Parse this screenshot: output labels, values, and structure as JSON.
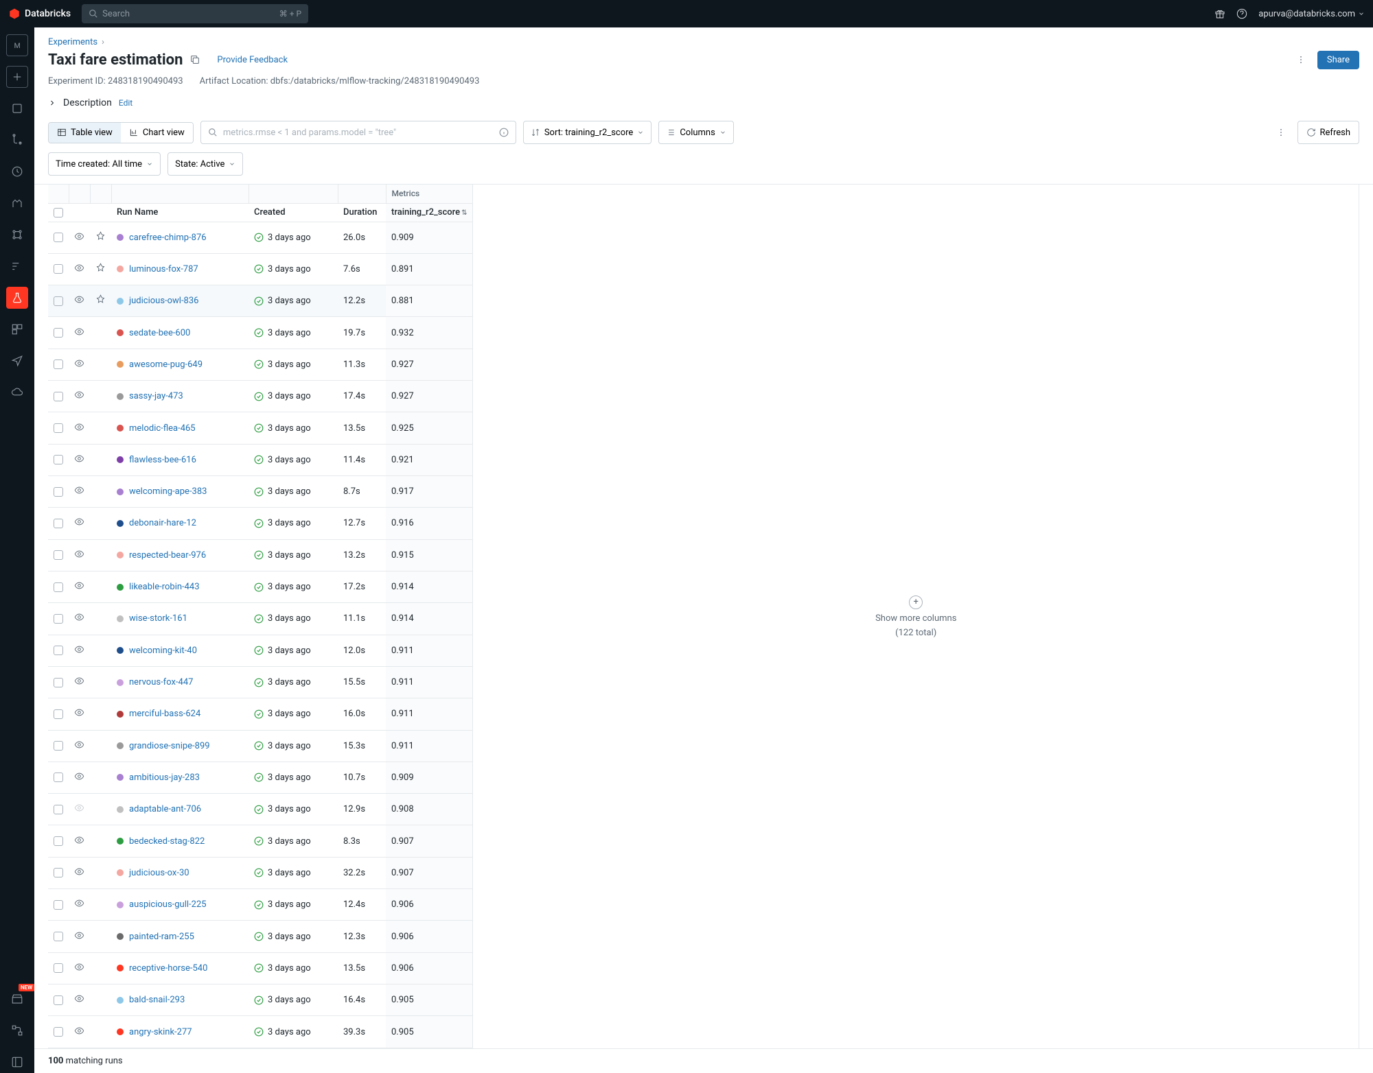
{
  "brand": "Databricks",
  "search": {
    "placeholder": "Search",
    "shortcut": "⌘ + P"
  },
  "user_email": "apurva@databricks.com",
  "breadcrumb": {
    "parent": "Experiments"
  },
  "page": {
    "title": "Taxi fare estimation",
    "feedback": "Provide Feedback",
    "share": "Share",
    "experiment_id_label": "Experiment ID:",
    "experiment_id": "248318190490493",
    "artifact_label": "Artifact Location:",
    "artifact_location": "dbfs:/databricks/mlflow-tracking/248318190490493",
    "description_label": "Description",
    "edit": "Edit"
  },
  "toolbar": {
    "table_view": "Table view",
    "chart_view": "Chart view",
    "filter_placeholder": "metrics.rmse < 1 and params.model = \"tree\"",
    "sort_label": "Sort: training_r2_score",
    "columns_label": "Columns",
    "refresh": "Refresh"
  },
  "filters": {
    "time": "Time created: All time",
    "state": "State: Active"
  },
  "table": {
    "group_metrics": "Metrics",
    "cols": {
      "run_name": "Run Name",
      "created": "Created",
      "duration": "Duration",
      "metric": "training_r2_score"
    },
    "created_text": "3 days ago",
    "more_cols_line1": "Show more columns",
    "more_cols_line2": "(122 total)"
  },
  "footer": {
    "count": "100",
    "label": "matching runs"
  },
  "new_badge": "NEW",
  "runs": [
    {
      "name": "carefree-chimp-876",
      "color": "#a87fd1",
      "duration": "26.0s",
      "metric": "0.909",
      "pinned": true
    },
    {
      "name": "luminous-fox-787",
      "color": "#f4a7a0",
      "duration": "7.6s",
      "metric": "0.891",
      "pinned": true
    },
    {
      "name": "judicious-owl-836",
      "color": "#8ec8e8",
      "duration": "12.2s",
      "metric": "0.881",
      "pinned": true,
      "hover": true
    },
    {
      "name": "sedate-bee-600",
      "color": "#d9534f",
      "duration": "19.7s",
      "metric": "0.932"
    },
    {
      "name": "awesome-pug-649",
      "color": "#e89c5e",
      "duration": "11.3s",
      "metric": "0.927"
    },
    {
      "name": "sassy-jay-473",
      "color": "#9a9a9a",
      "duration": "17.4s",
      "metric": "0.927"
    },
    {
      "name": "melodic-flea-465",
      "color": "#d9534f",
      "duration": "13.5s",
      "metric": "0.925"
    },
    {
      "name": "flawless-bee-616",
      "color": "#7e3fa8",
      "duration": "11.4s",
      "metric": "0.921"
    },
    {
      "name": "welcoming-ape-383",
      "color": "#a87fd1",
      "duration": "8.7s",
      "metric": "0.917"
    },
    {
      "name": "debonair-hare-12",
      "color": "#1f4e8c",
      "duration": "12.7s",
      "metric": "0.916"
    },
    {
      "name": "respected-bear-976",
      "color": "#f4a7a0",
      "duration": "13.2s",
      "metric": "0.915"
    },
    {
      "name": "likeable-robin-443",
      "color": "#2d9d41",
      "duration": "17.2s",
      "metric": "0.914"
    },
    {
      "name": "wise-stork-161",
      "color": "#c0c0c0",
      "duration": "11.1s",
      "metric": "0.914"
    },
    {
      "name": "welcoming-kit-40",
      "color": "#1f4e8c",
      "duration": "12.0s",
      "metric": "0.911"
    },
    {
      "name": "nervous-fox-447",
      "color": "#c9a0dc",
      "duration": "15.5s",
      "metric": "0.911"
    },
    {
      "name": "merciful-bass-624",
      "color": "#b03a3a",
      "duration": "16.0s",
      "metric": "0.911"
    },
    {
      "name": "grandiose-snipe-899",
      "color": "#9a9a9a",
      "duration": "15.3s",
      "metric": "0.911"
    },
    {
      "name": "ambitious-jay-283",
      "color": "#a87fd1",
      "duration": "10.7s",
      "metric": "0.909"
    },
    {
      "name": "adaptable-ant-706",
      "color": "#c0c0c0",
      "duration": "12.9s",
      "metric": "0.908",
      "hidden": true
    },
    {
      "name": "bedecked-stag-822",
      "color": "#2d9d41",
      "duration": "8.3s",
      "metric": "0.907"
    },
    {
      "name": "judicious-ox-30",
      "color": "#f4a7a0",
      "duration": "32.2s",
      "metric": "0.907"
    },
    {
      "name": "auspicious-gull-225",
      "color": "#c9a0dc",
      "duration": "12.4s",
      "metric": "0.906"
    },
    {
      "name": "painted-ram-255",
      "color": "#6b6b6b",
      "duration": "12.3s",
      "metric": "0.906"
    },
    {
      "name": "receptive-horse-540",
      "color": "#ff3621",
      "duration": "13.5s",
      "metric": "0.906"
    },
    {
      "name": "bald-snail-293",
      "color": "#8ec8e8",
      "duration": "16.4s",
      "metric": "0.905"
    },
    {
      "name": "angry-skink-277",
      "color": "#ff3621",
      "duration": "39.3s",
      "metric": "0.905"
    }
  ]
}
